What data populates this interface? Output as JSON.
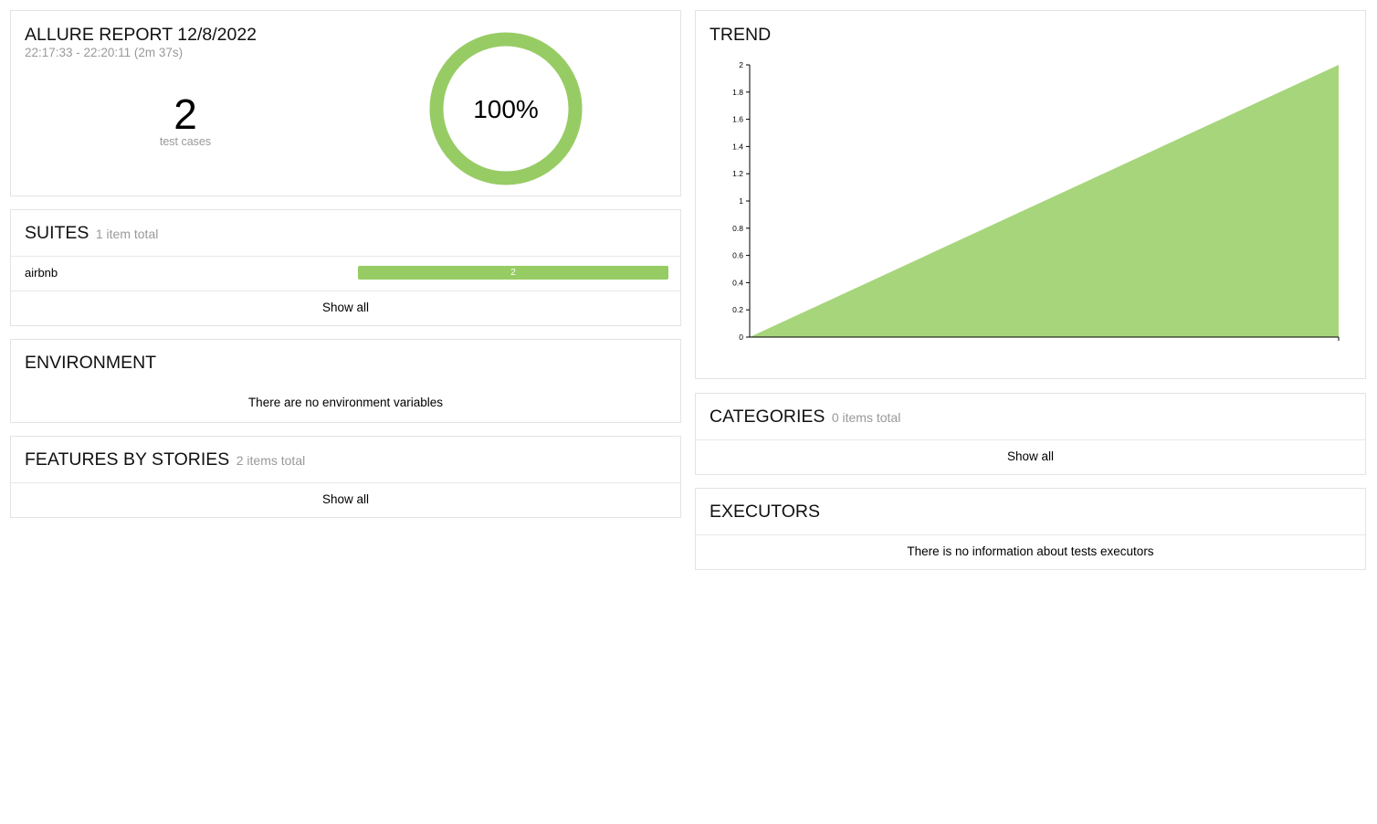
{
  "summary": {
    "title": "ALLURE REPORT 12/8/2022",
    "time_range": "22:17:33 - 22:20:11 (2m 37s)",
    "test_case_count": "2",
    "test_case_label": "test cases",
    "success_rate_text": "100%",
    "success_rate": 1.0,
    "status_colors": {
      "passed": "#97cc64"
    }
  },
  "suites": {
    "title": "SUITES",
    "count_label": "1 item total",
    "items": [
      {
        "name": "airbnb",
        "passed": 2,
        "bar_label": "2"
      }
    ],
    "show_all_label": "Show all"
  },
  "environment": {
    "title": "ENVIRONMENT",
    "empty_message": "There are no environment variables"
  },
  "features": {
    "title": "FEATURES BY STORIES",
    "count_label": "2 items total",
    "show_all_label": "Show all"
  },
  "trend": {
    "title": "TREND"
  },
  "chart_data": {
    "type": "area",
    "title": "TREND",
    "xlabel": "",
    "ylabel": "",
    "x": [
      0,
      1
    ],
    "series": [
      {
        "values": [
          0,
          2
        ],
        "color": "#a7d57b"
      }
    ],
    "ylim": [
      0,
      2
    ],
    "yticks": [
      0,
      0.2,
      0.4,
      0.6,
      0.8,
      1,
      1.2,
      1.4,
      1.6,
      1.8,
      2
    ],
    "ytick_labels": [
      "0",
      "0.2",
      "0.4",
      "0.6",
      "0.8",
      "1",
      "1.2",
      "1.4",
      "1.6",
      "1.8",
      "2"
    ],
    "grid": false,
    "legend": "none"
  },
  "categories": {
    "title": "CATEGORIES",
    "count_label": "0 items total",
    "show_all_label": "Show all"
  },
  "executors": {
    "title": "EXECUTORS",
    "empty_message": "There is no information about tests executors"
  }
}
